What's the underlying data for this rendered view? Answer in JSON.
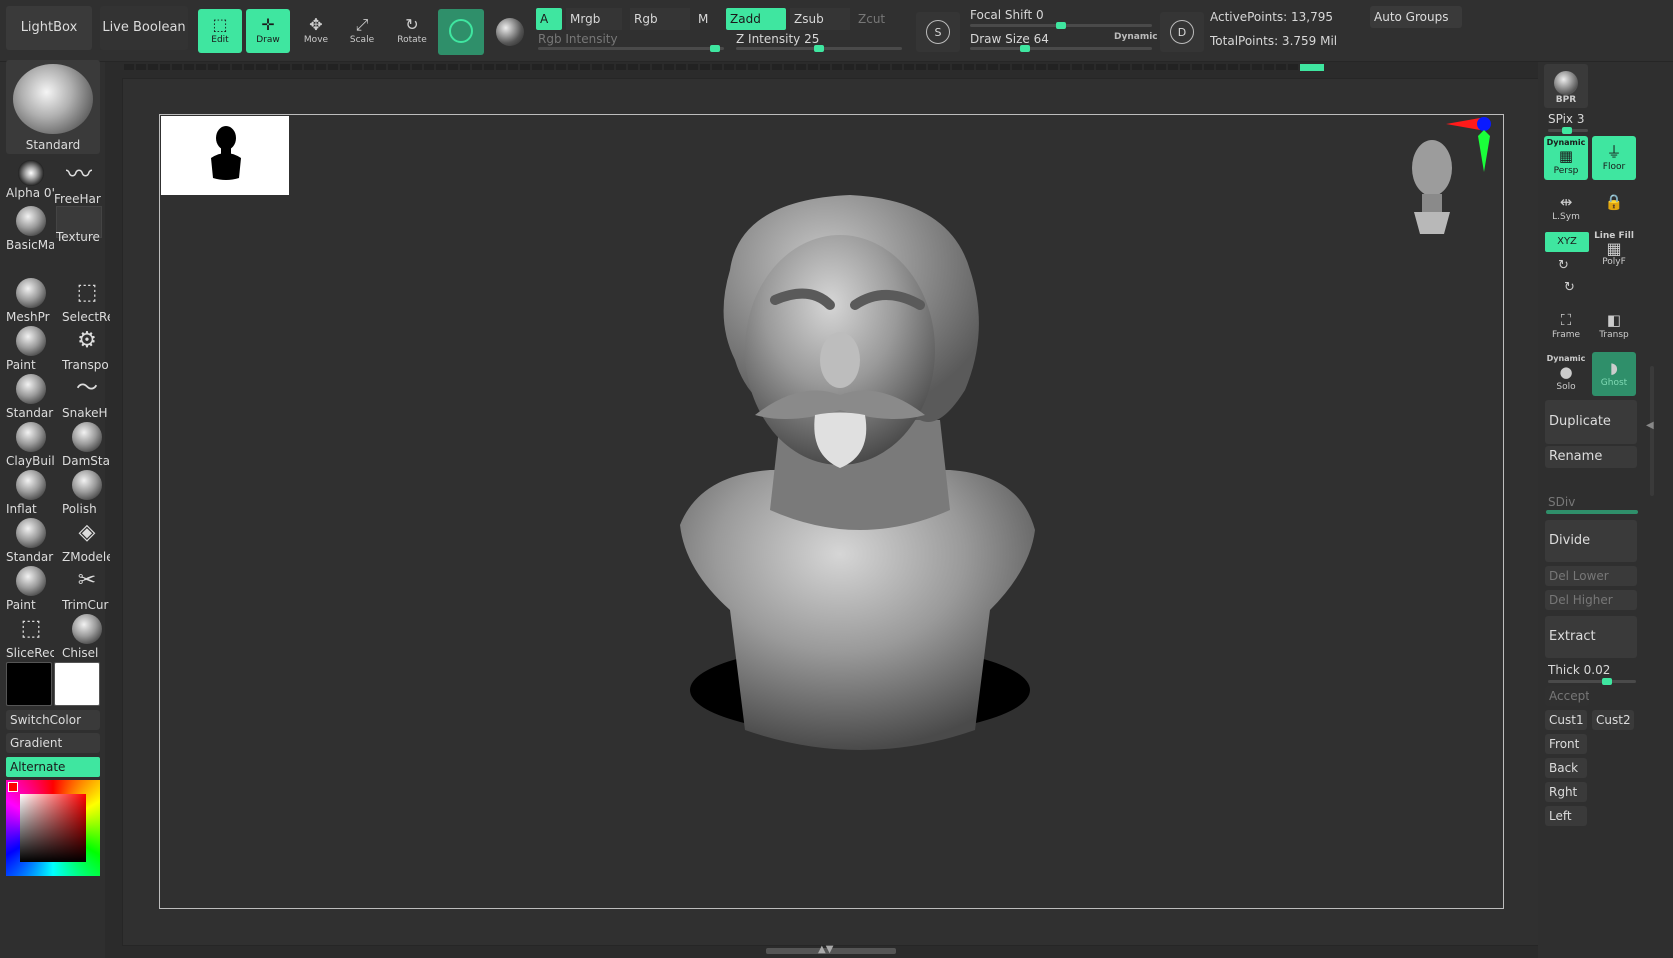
{
  "topbar": {
    "lightbox": "LightBox",
    "live_boolean": "Live Boolean",
    "tools": {
      "edit": "Edit",
      "draw": "Draw",
      "move": "Move",
      "scale": "Scale",
      "rotate": "Rotate"
    },
    "a_label": "A",
    "mrgb": "Mrgb",
    "rgb": "Rgb",
    "m": "M",
    "rgb_intensity": "Rgb Intensity",
    "zadd": "Zadd",
    "zsub": "Zsub",
    "zcut": "Zcut",
    "z_intensity_label": "Z Intensity",
    "z_intensity_value": "25",
    "focal_shift_label": "Focal Shift",
    "focal_shift_value": "0",
    "draw_size_label": "Draw Size",
    "draw_size_value": "64",
    "dynamic": "Dynamic",
    "s_label": "S",
    "d_label": "D",
    "active_points": "ActivePoints: 13,795",
    "total_points": "TotalPoints: 3.759 Mil",
    "auto_groups": "Auto Groups"
  },
  "leftbar": {
    "current_brush": "Standard",
    "alpha": "Alpha 0'",
    "stroke": "FreeHar",
    "material": "BasicMa",
    "texture": "Texture",
    "brushes": [
      "MeshPr",
      "SelectRe",
      "Paint",
      "Transpo",
      "Standar",
      "SnakeH",
      "ClayBuil",
      "DamSta",
      "Inflat",
      "Polish",
      "Standar",
      "ZModele",
      "Paint",
      "TrimCur",
      "SliceRec",
      "Chisel"
    ],
    "switch_color": "SwitchColor",
    "gradient": "Gradient",
    "alternate": "Alternate"
  },
  "rightbar": {
    "bpr": "BPR",
    "spix_label": "SPix",
    "spix_value": "3",
    "dynamic_persp": "Dynamic",
    "persp": "Persp",
    "floor": "Floor",
    "lsym": "L.Sym",
    "xyz": "XYZ",
    "line_fill": "Line Fill",
    "polyf": "PolyF",
    "frame": "Frame",
    "transp": "Transp",
    "dynamic_solo": "Dynamic",
    "solo": "Solo",
    "ghost": "Ghost",
    "duplicate": "Duplicate",
    "rename": "Rename",
    "sdiv": "SDiv",
    "divide": "Divide",
    "del_lower": "Del Lower",
    "del_higher": "Del Higher",
    "extract": "Extract",
    "thick_label": "Thick",
    "thick_value": "0.02",
    "accept": "Accept",
    "cust1": "Cust1",
    "cust2": "Cust2",
    "front": "Front",
    "back": "Back",
    "rght": "Rght",
    "left": "Left"
  },
  "colors": {
    "accent": "#3fe6a0",
    "panel": "#2f2f2f",
    "canvas": "#303030"
  }
}
